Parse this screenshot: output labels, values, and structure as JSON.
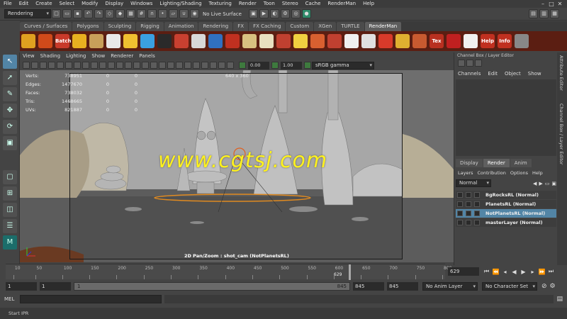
{
  "menubar": {
    "items": [
      "File",
      "Edit",
      "Create",
      "Select",
      "Modify",
      "Display",
      "Windows",
      "Lighting/Shading",
      "Texturing",
      "Render",
      "Toon",
      "Stereo",
      "Cache",
      "RenderMan",
      "Help"
    ]
  },
  "statusline": {
    "menuset": "Rendering",
    "live_surface": "No Live Surface"
  },
  "shelf": {
    "tabs": [
      "Curves / Surfaces",
      "Polygons",
      "Sculpting",
      "Rigging",
      "Animation",
      "Rendering",
      "FX",
      "FX Caching",
      "Custom",
      "XGen",
      "TURTLE",
      "RenderMan"
    ],
    "active_tab": "RenderMan",
    "icons": [
      {
        "label": "",
        "color": "#e0a020"
      },
      {
        "label": "",
        "color": "#d04a1a"
      },
      {
        "label": "Batch",
        "color": "#c83a2a"
      },
      {
        "label": "",
        "color": "#e8b020"
      },
      {
        "label": "",
        "color": "#c8a05a"
      },
      {
        "label": "",
        "color": "#e8e8e8"
      },
      {
        "label": "",
        "color": "#f0c030"
      },
      {
        "label": "",
        "color": "#3aa0e0"
      },
      {
        "label": "",
        "color": "#2a2a2a"
      },
      {
        "label": "",
        "color": "#c84030"
      },
      {
        "label": "",
        "color": "#d8d8d8"
      },
      {
        "label": "",
        "color": "#3070c0"
      },
      {
        "label": "",
        "color": "#c03020"
      },
      {
        "label": "",
        "color": "#d8c080"
      },
      {
        "label": "",
        "color": "#e8e0c0"
      },
      {
        "label": "",
        "color": "#c04030"
      },
      {
        "label": "",
        "color": "#f0d040"
      },
      {
        "label": "",
        "color": "#d86030"
      },
      {
        "label": "",
        "color": "#c04030"
      },
      {
        "label": "",
        "color": "#f0f0f0"
      },
      {
        "label": "",
        "color": "#e0e0e0"
      },
      {
        "label": "",
        "color": "#d83a2a"
      },
      {
        "label": "",
        "color": "#e0b030"
      },
      {
        "label": "",
        "color": "#c85a30"
      },
      {
        "label": "Tex",
        "color": "#b83020"
      },
      {
        "label": "",
        "color": "#c02020"
      },
      {
        "label": "",
        "color": "#f0f0f0"
      },
      {
        "label": "Help",
        "color": "#c03020"
      },
      {
        "label": "Info",
        "color": "#c03020"
      },
      {
        "label": "",
        "color": "#888888"
      }
    ]
  },
  "viewport": {
    "menu": [
      "View",
      "Shading",
      "Lighting",
      "Show",
      "Renderer",
      "Panels"
    ],
    "field_a": "0.00",
    "field_b": "1.00",
    "colorspace": "sRGB gamma",
    "resolution": "640 x 360",
    "camera_label": "2D Pan/Zoom : shot_cam (NotPlanetsRL)",
    "hud": [
      {
        "k": "Verts:",
        "v1": "738951",
        "v2": "0",
        "v3": "0"
      },
      {
        "k": "Edges:",
        "v1": "1477670",
        "v2": "0",
        "v3": "0"
      },
      {
        "k": "Faces:",
        "v1": "738032",
        "v2": "0",
        "v3": "0"
      },
      {
        "k": "Tris:",
        "v1": "1468665",
        "v2": "0",
        "v3": "0"
      },
      {
        "k": "UVs:",
        "v1": "821887",
        "v2": "0",
        "v3": "0"
      }
    ],
    "watermark": "www.cgtsj.com"
  },
  "channelbox": {
    "title": "Channel Box / Layer Editor",
    "menu": [
      "Channels",
      "Edit",
      "Object",
      "Show"
    ]
  },
  "layer_editor": {
    "tabs": [
      "Display",
      "Render",
      "Anim"
    ],
    "active_tab": "Render",
    "menu": [
      "Layers",
      "Contribution",
      "Options",
      "Help"
    ],
    "blend_mode": "Normal",
    "layers": [
      {
        "name": "BgRocksRL (Normal)",
        "selected": false
      },
      {
        "name": "PlanetsRL (Normal)",
        "selected": false
      },
      {
        "name": "NotPlanetsRL (Normal)",
        "selected": true
      },
      {
        "name": "masterLayer (Normal)",
        "selected": false
      }
    ]
  },
  "sidetabs": {
    "attribute_editor": "Attribute Editor",
    "channel_box": "Channel Box / Layer Editor"
  },
  "timeline": {
    "ticks": [
      "10",
      "50",
      "100",
      "150",
      "200",
      "250",
      "300",
      "350",
      "400",
      "450",
      "500",
      "550",
      "600",
      "650",
      "700",
      "750",
      "800"
    ],
    "current_frame_label": "629",
    "current_frame_field": "629",
    "start": 1,
    "end": 800,
    "current": 629
  },
  "range": {
    "start_field": "1",
    "playback_start": "1",
    "slider_left": "1",
    "slider_right": "845",
    "playback_end": "845",
    "end_field": "845",
    "anim_layer": "No Anim Layer",
    "character_set": "No Character Set"
  },
  "cmdline": {
    "label": "MEL"
  },
  "helpline": {
    "text": "Start IPR"
  },
  "colors": {
    "accent": "#5285a6",
    "shelf_bg": "#5b1e12",
    "watermark": "#fff21e"
  }
}
